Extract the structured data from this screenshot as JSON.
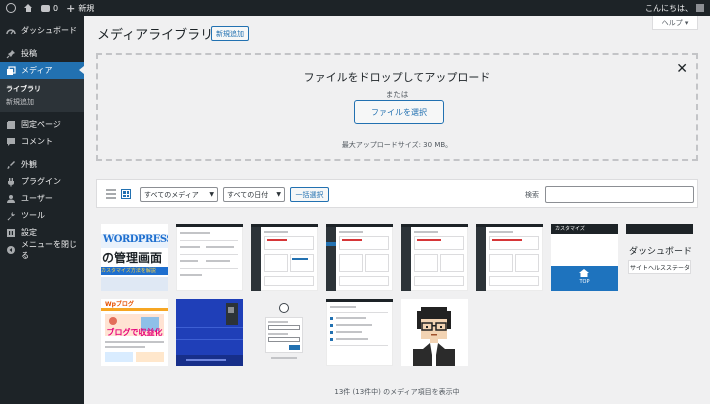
{
  "adminbar": {
    "new_label": "新規",
    "comments_count": "0",
    "greeting": "こんにちは、"
  },
  "sidebar": {
    "items": [
      {
        "label": "ダッシュボード",
        "icon": "dashboard-icon"
      },
      {
        "label": "投稿",
        "icon": "pin-icon"
      },
      {
        "label": "メディア",
        "icon": "media-icon"
      },
      {
        "label": "固定ページ",
        "icon": "page-icon"
      },
      {
        "label": "コメント",
        "icon": "comment-icon"
      },
      {
        "label": "外観",
        "icon": "brush-icon"
      },
      {
        "label": "プラグイン",
        "icon": "plugin-icon"
      },
      {
        "label": "ユーザー",
        "icon": "user-icon"
      },
      {
        "label": "ツール",
        "icon": "wrench-icon"
      },
      {
        "label": "設定",
        "icon": "settings-icon"
      },
      {
        "label": "メニューを閉じる",
        "icon": "collapse-icon"
      }
    ],
    "submenu": [
      {
        "label": "ライブラリ"
      },
      {
        "label": "新規追加"
      }
    ]
  },
  "help_tab": "ヘルプ ▾",
  "header": {
    "title": "メディアライブラリ",
    "add_new": "新規追加"
  },
  "uploader": {
    "drop_title": "ファイルをドロップしてアップロード",
    "or_text": "または",
    "select_button": "ファイルを選択",
    "max_size": "最大アップロードサイズ: 30 MB。"
  },
  "toolbar": {
    "media_filter": "すべてのメディア",
    "date_filter": "すべての日付",
    "bulk_select": "一括選択",
    "search_label": "検索"
  },
  "thumbnails": {
    "t1_line1": "WORDPRESS",
    "t1_line2": "の管理画面",
    "t1_line3": "カスタマイズ方法を解説",
    "t9_line1": "ダッシュボード",
    "t9_line2": "サイトヘルスステータ",
    "t8_top": "TOP",
    "t8_bar": "カスタマイズ",
    "t10_heading": "ブログで収益化"
  },
  "footer": {
    "count": "13件 (13件中) のメディア項目を表示中"
  }
}
